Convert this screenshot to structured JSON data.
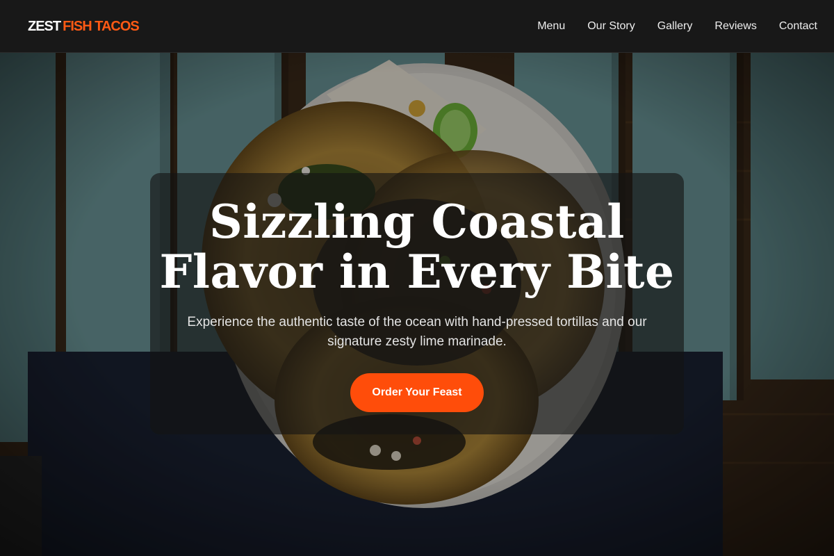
{
  "brand": {
    "word1": "ZEST",
    "word2": "FISH TACOS",
    "accent_color": "#ff5a14"
  },
  "nav": {
    "items": [
      {
        "label": "Menu"
      },
      {
        "label": "Our Story"
      },
      {
        "label": "Gallery"
      },
      {
        "label": "Reviews"
      },
      {
        "label": "Contact"
      }
    ]
  },
  "hero": {
    "title_line1": "Sizzling Coastal",
    "title_line2": "Flavor in Every Bite",
    "subtitle": "Experience the authentic taste of the ocean with hand-pressed tortillas and our signature zesty lime marinade.",
    "cta_label": "Order Your Feast",
    "cta_color": "#ff4d0a"
  }
}
